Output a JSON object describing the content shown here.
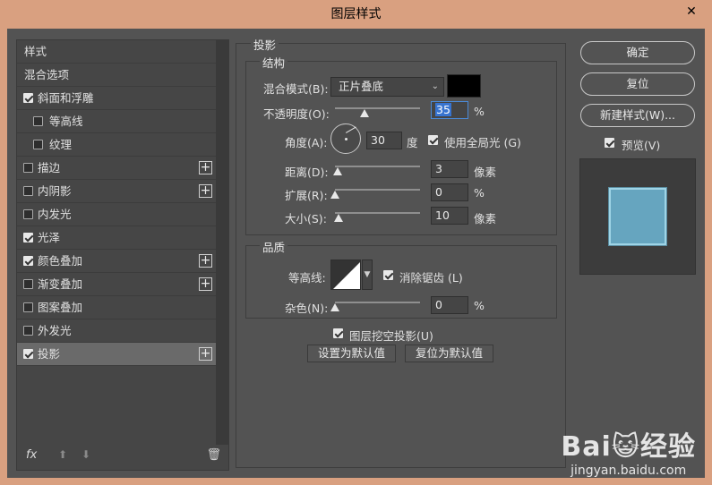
{
  "window": {
    "title": "图层样式",
    "close": "✕"
  },
  "left_panel": {
    "items": [
      {
        "label": "样式",
        "checkbox": null,
        "plus": false,
        "sub": false,
        "selected": false
      },
      {
        "label": "混合选项",
        "checkbox": null,
        "plus": false,
        "sub": false,
        "selected": false
      },
      {
        "label": "斜面和浮雕",
        "checkbox": true,
        "plus": false,
        "sub": false,
        "selected": false
      },
      {
        "label": "等高线",
        "checkbox": false,
        "plus": false,
        "sub": true,
        "selected": false
      },
      {
        "label": "纹理",
        "checkbox": false,
        "plus": false,
        "sub": true,
        "selected": false
      },
      {
        "label": "描边",
        "checkbox": false,
        "plus": true,
        "sub": false,
        "selected": false
      },
      {
        "label": "内阴影",
        "checkbox": false,
        "plus": true,
        "sub": false,
        "selected": false
      },
      {
        "label": "内发光",
        "checkbox": false,
        "plus": false,
        "sub": false,
        "selected": false
      },
      {
        "label": "光泽",
        "checkbox": true,
        "plus": false,
        "sub": false,
        "selected": false
      },
      {
        "label": "颜色叠加",
        "checkbox": true,
        "plus": true,
        "sub": false,
        "selected": false
      },
      {
        "label": "渐变叠加",
        "checkbox": false,
        "plus": true,
        "sub": false,
        "selected": false
      },
      {
        "label": "图案叠加",
        "checkbox": false,
        "plus": false,
        "sub": false,
        "selected": false
      },
      {
        "label": "外发光",
        "checkbox": false,
        "plus": false,
        "sub": false,
        "selected": false
      },
      {
        "label": "投影",
        "checkbox": true,
        "plus": true,
        "sub": false,
        "selected": true
      }
    ],
    "footer": {
      "fx": "fx",
      "up": "⬆",
      "down": "⬇",
      "trash": "🗑"
    }
  },
  "drop_shadow": {
    "section_title": "投影",
    "structure": {
      "title": "结构",
      "blend_mode_label": "混合模式(B):",
      "blend_mode_value": "正片叠底",
      "shadow_color": "#000000",
      "opacity_label": "不透明度(O):",
      "opacity_value": "35",
      "opacity_unit": "%",
      "opacity_level": 0.35,
      "angle_label": "角度(A):",
      "angle_value": "30",
      "angle_unit": "度",
      "global_light_label": "使用全局光 (G)",
      "global_light_checked": true,
      "distance_label": "距离(D):",
      "distance_value": "3",
      "distance_unit": "像素",
      "distance_level": 0.03,
      "spread_label": "扩展(R):",
      "spread_value": "0",
      "spread_unit": "%",
      "spread_level": 0.0,
      "size_label": "大小(S):",
      "size_value": "10",
      "size_unit": "像素",
      "size_level": 0.04
    },
    "quality": {
      "title": "品质",
      "contour_label": "等高线:",
      "anti_alias_label": "消除锯齿 (L)",
      "anti_alias_checked": true,
      "noise_label": "杂色(N):",
      "noise_value": "0",
      "noise_unit": "%",
      "noise_level": 0.0
    },
    "knockout_label": "图层挖空投影(U)",
    "knockout_checked": true,
    "make_default": "设置为默认值",
    "reset_default": "复位为默认值"
  },
  "right_panel": {
    "ok": "确定",
    "reset": "复位",
    "new_style": "新建样式(W)...",
    "preview_label": "预览(V)",
    "preview_checked": true,
    "preview_fill": "#66a5bf"
  },
  "watermark": {
    "line1": "Bai😺经验",
    "line2": "jingyan.baidu.com"
  }
}
